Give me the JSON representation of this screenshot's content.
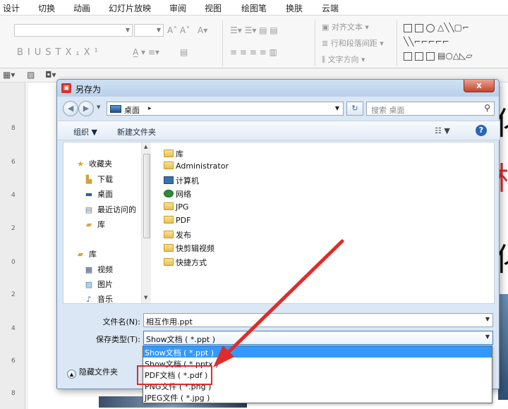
{
  "app_menu": {
    "items": [
      "设计",
      "切换",
      "动画",
      "幻灯片放映",
      "审阅",
      "视图",
      "绘图笔",
      "换肤",
      "云端"
    ]
  },
  "ribbon": {
    "align_text": "对齐文本",
    "line_spacing": "行和段落间距",
    "text_direction": "文字方向",
    "format_buttons": [
      "B",
      "I",
      "U",
      "S",
      "T",
      "X₁",
      "X¹"
    ]
  },
  "ruler": {
    "ticks": [
      "8",
      "6",
      "4",
      "2",
      "0",
      "2",
      "4",
      "6",
      "8"
    ]
  },
  "dialog": {
    "title": "另存为",
    "close_label": "x",
    "address": {
      "location": "桌面",
      "sep": "▸",
      "search_placeholder": "搜索 桌面"
    },
    "toolbar": {
      "organize": "组织 ▼",
      "new_folder": "新建文件夹",
      "view_label": "☷ ▼",
      "help": "?"
    },
    "nav": {
      "favorites": "收藏夹",
      "favorite_items": [
        "下载",
        "桌面",
        "最近访问的",
        "库"
      ],
      "libraries": "库",
      "library_items": [
        "视频",
        "图片",
        "音乐"
      ]
    },
    "files": [
      "库",
      "Administrator",
      "计算机",
      "网络",
      "JPG",
      "PDF",
      "发布",
      "快剪辑视频",
      "快捷方式"
    ],
    "filename_label": "文件名(N):",
    "filename_value": "相互作用.ppt",
    "filetype_label": "保存类型(T):",
    "filetype_value": "Show文档 ( *.ppt )",
    "hide_folders": "隐藏文件夹",
    "type_options": [
      "Show文档 ( *.ppt )",
      "Show文档 ( *.pptx )",
      "PDF文档 ( *.pdf )",
      "PNG文件 ( *.png )",
      "JPEG文件 ( *.jpg )"
    ]
  },
  "colors": {
    "accent": "#3399ff",
    "annotation": "#e02b2b"
  }
}
